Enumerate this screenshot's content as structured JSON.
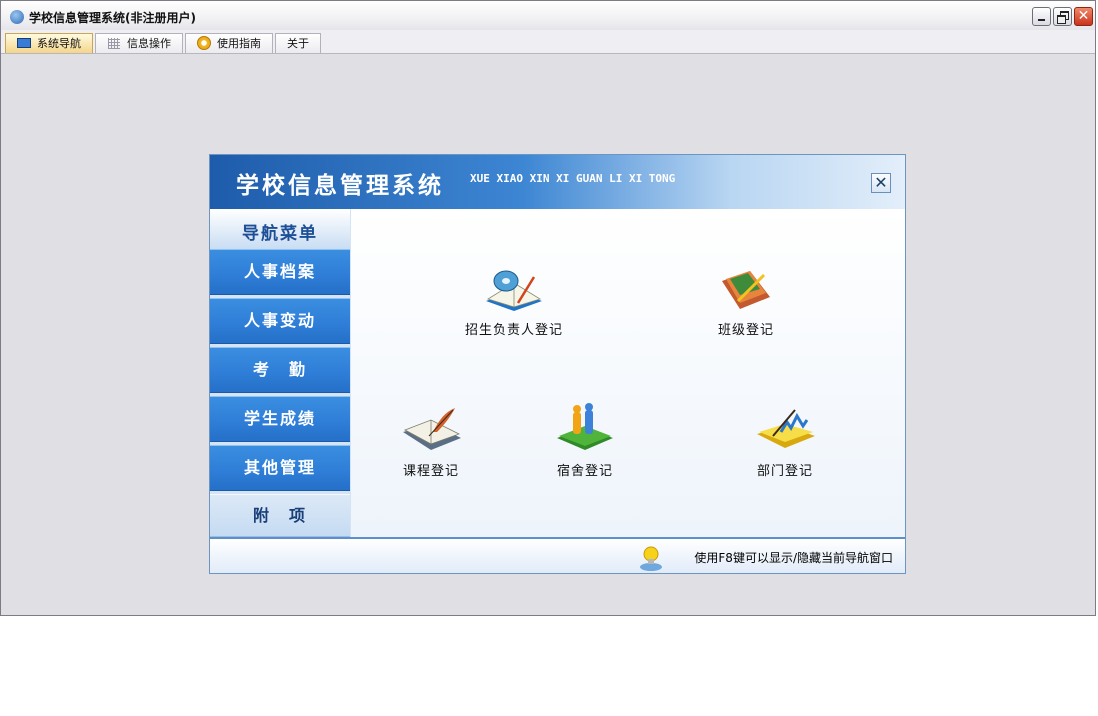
{
  "window": {
    "title": "学校信息管理系统(非注册用户)"
  },
  "tabs": [
    {
      "label": "系统导航",
      "icon": "monitor-icon",
      "active": true
    },
    {
      "label": "信息操作",
      "icon": "grid-icon",
      "active": false
    },
    {
      "label": "使用指南",
      "icon": "help-icon",
      "active": false
    },
    {
      "label": "关于",
      "icon": "",
      "active": false
    }
  ],
  "panel": {
    "title": "学校信息管理系统",
    "pinyin": "XUE XIAO XIN XI GUAN LI XI TONG",
    "close_label": "✕"
  },
  "nav": {
    "heading": "导航菜单",
    "items": [
      {
        "label": "人事档案"
      },
      {
        "label": "人事变动"
      },
      {
        "label": "考　勤"
      },
      {
        "label": "学生成绩"
      },
      {
        "label": "其他管理"
      },
      {
        "label": "附　项"
      }
    ]
  },
  "functions": [
    {
      "label": "招生负责人登记",
      "icon": "book-cd-icon"
    },
    {
      "label": "班级登记",
      "icon": "notebook-pen-icon"
    },
    {
      "label": "课程登记",
      "icon": "open-book-quill-icon"
    },
    {
      "label": "宿舍登记",
      "icon": "people-book-icon"
    },
    {
      "label": "部门登记",
      "icon": "chart-pen-icon"
    }
  ],
  "status": {
    "hint": "使用F8键可以显示/隐藏当前导航窗口"
  },
  "colors": {
    "accent": "#2f7ed8",
    "header_start": "#1e5cab",
    "tab_active": "#f4d58a"
  }
}
